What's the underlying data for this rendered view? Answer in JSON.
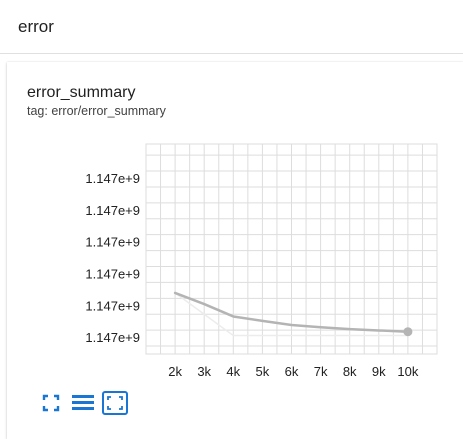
{
  "section": {
    "title": "error"
  },
  "card": {
    "title": "error_summary",
    "tag": "tag: error/error_summary"
  },
  "toolbar": {
    "icons": [
      "fullscreen-icon",
      "data-table-icon",
      "fit-domain-icon"
    ]
  },
  "colors": {
    "accent": "#1976d2",
    "series": "#b4b4b4",
    "series_raw": "#ececec",
    "grid": "#dddddd"
  },
  "chart_data": {
    "type": "line",
    "title": "error_summary",
    "xlabel": "",
    "ylabel": "",
    "x_ticks": [
      2000,
      3000,
      4000,
      5000,
      6000,
      7000,
      8000,
      9000,
      10000
    ],
    "x_tick_labels": [
      "2k",
      "3k",
      "4k",
      "5k",
      "6k",
      "7k",
      "8k",
      "9k",
      "10k"
    ],
    "y_tick_labels": [
      "1.147e+9",
      "1.147e+9",
      "1.147e+9",
      "1.147e+9",
      "1.147e+9",
      "1.147e+9"
    ],
    "xlim": [
      1000,
      11000
    ],
    "ylim": [
      0,
      6.6
    ],
    "y_ticks": [
      5.5,
      4.5,
      3.5,
      2.5,
      1.5,
      0.5
    ],
    "grid": true,
    "series": [
      {
        "role": "smoothed",
        "x": [
          2000,
          3000,
          4000,
          5000,
          6000,
          7000,
          8000,
          9000,
          10000
        ],
        "y": [
          1.92,
          1.57,
          1.18,
          1.04,
          0.91,
          0.84,
          0.78,
          0.74,
          0.7
        ]
      },
      {
        "role": "raw",
        "x": [
          2000,
          3000,
          4000,
          5000,
          6000,
          7000,
          8000,
          9000,
          10000
        ],
        "y": [
          1.92,
          1.25,
          0.58,
          0.58,
          0.58,
          0.58,
          0.58,
          0.58,
          0.58
        ]
      }
    ],
    "marker_last": true
  }
}
